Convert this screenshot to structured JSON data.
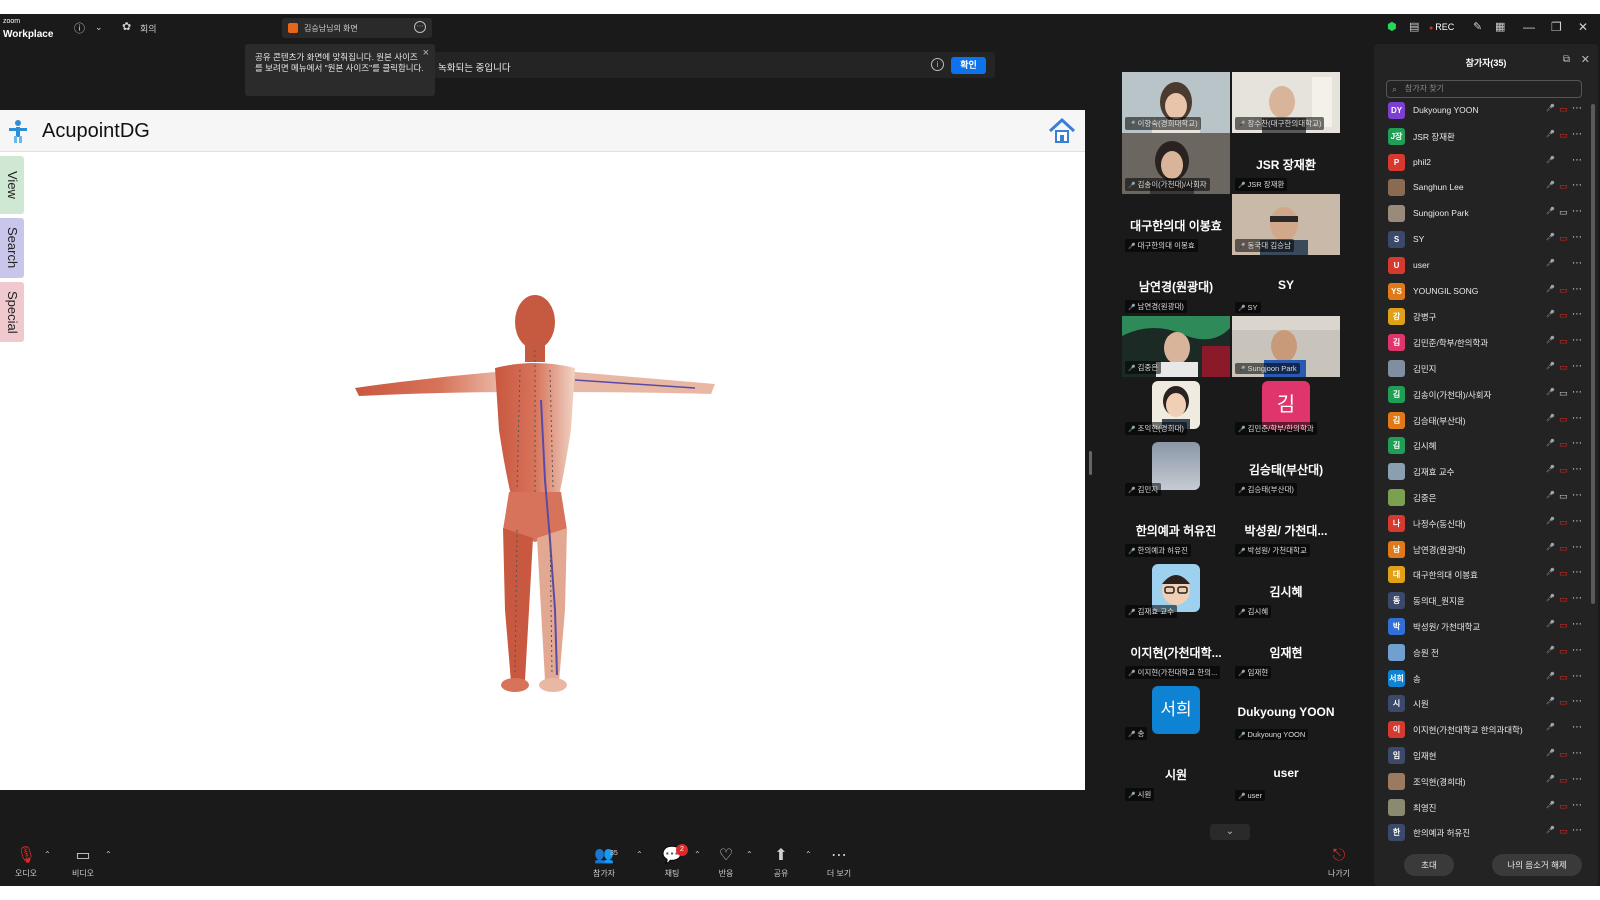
{
  "titlebar": {
    "logo_small": "zoom",
    "logo_main": "Workplace",
    "meeting_label": "회의",
    "share_tab_label": "김승남님의 화면",
    "rec_label": "REC"
  },
  "notice": {
    "text": "공유 콘텐츠가 화면에 맞춰집니다. 원본 사이즈를 보려면 메뉴에서 \"원본 사이즈\"를 클릭합니다."
  },
  "rec_banner": {
    "text": "녹화되는 중입니다",
    "ok_label": "확인"
  },
  "shared_app": {
    "title": "AcupointDG",
    "tabs": [
      {
        "label": "View",
        "color": "#cfe8d4"
      },
      {
        "label": "Search",
        "color": "#c9c6ec"
      },
      {
        "label": "Special",
        "color": "#f0c9cf"
      }
    ]
  },
  "gallery": {
    "tiles": [
      {
        "caption": "이향숙(경희대학교)",
        "big": "",
        "video": true
      },
      {
        "caption": "장수찬(대구한의대학교)",
        "big": "",
        "video": true
      },
      {
        "caption": "김송이(가천대)/사회자",
        "big": "",
        "video": true
      },
      {
        "caption": "JSR 장재환",
        "big": "JSR 장재환",
        "video": false
      },
      {
        "caption": "대구한의대 이봉효",
        "big": "대구한의대 이봉효",
        "video": false
      },
      {
        "caption": "동국대 김승남",
        "big": "",
        "video": true,
        "active": true
      },
      {
        "caption": "남연경(원광대)",
        "big": "남연경(원광대)",
        "video": false
      },
      {
        "caption": "SY",
        "big": "SY",
        "video": false
      },
      {
        "caption": "김중은",
        "big": "",
        "video": true
      },
      {
        "caption": "Sungjoon Park",
        "big": "",
        "video": true
      },
      {
        "caption": "조익현(경희대)",
        "big": "",
        "avatar": "photo"
      },
      {
        "caption": "김민준/학부/한의학과",
        "big": "",
        "avatar_text": "김",
        "avatar_color": "#e0356c"
      },
      {
        "caption": "김민지",
        "big": "",
        "avatar": "sky"
      },
      {
        "caption": "김승태(부산대)",
        "big": "김승태(부산대)",
        "video": false
      },
      {
        "caption": "한의예과 허유진",
        "big": "한의예과 허유진",
        "video": false
      },
      {
        "caption": "박성원/ 가천대학교",
        "big": "박성원/ 가천대...",
        "video": false
      },
      {
        "caption": "김재효 교수",
        "big": "",
        "avatar": "memoji"
      },
      {
        "caption": "김시혜",
        "big": "김시혜",
        "video": false
      },
      {
        "caption": "이지현(가천대학교 한의...",
        "big": "이지현(가천대학...",
        "video": false
      },
      {
        "caption": "임재현",
        "big": "임재현",
        "video": false
      },
      {
        "caption": "송",
        "big": "",
        "avatar_text": "서희",
        "avatar_color": "#0e83d4"
      },
      {
        "caption": "Dukyoung YOON",
        "big": "Dukyoung YOON",
        "video": false
      },
      {
        "caption": "시원",
        "big": "시원",
        "video": false
      },
      {
        "caption": "user",
        "big": "user",
        "video": false
      }
    ],
    "down_icon": "chevron-down-icon"
  },
  "participants": {
    "title": "참가자(35)",
    "search_placeholder": "참가자 찾기",
    "invite_label": "초대",
    "unmute_label": "나의 음소거 해제",
    "list": [
      {
        "initials": "DY",
        "color": "#7c3fd1",
        "name": "Dukyoung YOON",
        "cam": false
      },
      {
        "initials": "J장",
        "color": "#1f9e55",
        "name": "JSR 장재환",
        "cam": false
      },
      {
        "initials": "P",
        "color": "#d63a2f",
        "name": "phil2",
        "cam": null
      },
      {
        "initials": "",
        "color": "#8a6b52",
        "name": "Sanghun Lee",
        "cam": false
      },
      {
        "initials": "",
        "color": "#9a8a7a",
        "name": "Sungjoon Park",
        "cam": true
      },
      {
        "initials": "S",
        "color": "#3b4a6b",
        "name": "SY",
        "cam": false
      },
      {
        "initials": "U",
        "color": "#d63a2f",
        "name": "user",
        "cam": null
      },
      {
        "initials": "YS",
        "color": "#e07a18",
        "name": "YOUNGIL SONG",
        "cam": false
      },
      {
        "initials": "강",
        "color": "#e0a018",
        "name": "강병구",
        "cam": false
      },
      {
        "initials": "김",
        "color": "#e0356c",
        "name": "김민준/학부/한의학과",
        "cam": false
      },
      {
        "initials": "",
        "color": "#7f8ea0",
        "name": "김민지",
        "cam": false
      },
      {
        "initials": "김",
        "color": "#1f9e55",
        "name": "김송이(가천대)/사회자",
        "cam": true
      },
      {
        "initials": "김",
        "color": "#e07a18",
        "name": "김승태(부산대)",
        "cam": false
      },
      {
        "initials": "김",
        "color": "#1f9e55",
        "name": "김시혜",
        "cam": false
      },
      {
        "initials": "",
        "color": "#8aa0b0",
        "name": "김재효 교수",
        "cam": false
      },
      {
        "initials": "",
        "color": "#7aa050",
        "name": "김중은",
        "cam": true
      },
      {
        "initials": "나",
        "color": "#d63a2f",
        "name": "나정수(동신대)",
        "cam": false
      },
      {
        "initials": "남",
        "color": "#e07a18",
        "name": "남연경(원광대)",
        "cam": false
      },
      {
        "initials": "대",
        "color": "#e0a018",
        "name": "대구한의대 이봉효",
        "cam": false
      },
      {
        "initials": "동",
        "color": "#3b4a6b",
        "name": "동의대_원지윤",
        "cam": false
      },
      {
        "initials": "박",
        "color": "#2f6fd6",
        "name": "박성원/ 가천대학교",
        "cam": false
      },
      {
        "initials": "",
        "color": "#6fa0d0",
        "name": "승원 전",
        "cam": false
      },
      {
        "initials": "서희",
        "color": "#0e83d4",
        "name": "송",
        "cam": false
      },
      {
        "initials": "시",
        "color": "#3b4a6b",
        "name": "시원",
        "cam": false
      },
      {
        "initials": "이",
        "color": "#d63a2f",
        "name": "이지현(가천대학교 한의과대학)",
        "cam": null
      },
      {
        "initials": "임",
        "color": "#3b4a6b",
        "name": "임재현",
        "cam": false
      },
      {
        "initials": "",
        "color": "#9a7a60",
        "name": "조익현(경희대)",
        "cam": false
      },
      {
        "initials": "",
        "color": "#8a8a70",
        "name": "최영진",
        "cam": false
      },
      {
        "initials": "한",
        "color": "#3b4a6b",
        "name": "한의예과 허유진",
        "cam": false
      }
    ]
  },
  "toolbar": {
    "audio_label": "오디오",
    "video_label": "비디오",
    "participants_label": "참가자",
    "participants_count": "35",
    "chat_label": "채팅",
    "chat_badge": "2",
    "react_label": "반응",
    "share_label": "공유",
    "more_label": "더 보기",
    "leave_label": "나가기"
  }
}
